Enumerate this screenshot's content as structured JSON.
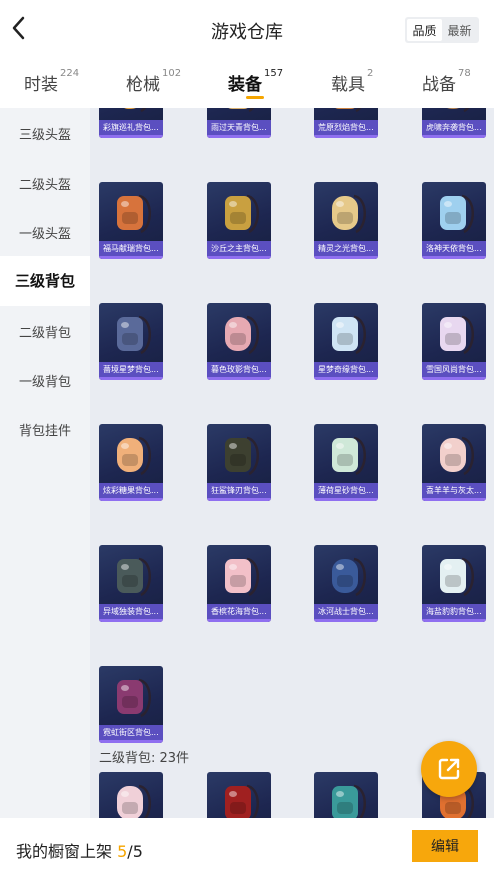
{
  "header": {
    "title": "游戏仓库",
    "sort_options": [
      "品质",
      "最新"
    ],
    "sort_active": 0
  },
  "tabs": [
    {
      "label": "时装",
      "count": "224"
    },
    {
      "label": "枪械",
      "count": "102"
    },
    {
      "label": "装备",
      "count": "157"
    },
    {
      "label": "载具",
      "count": "2"
    },
    {
      "label": "战备",
      "count": "78"
    }
  ],
  "active_tab": 2,
  "sidebar": {
    "items": [
      "三级头盔",
      "二级头盔",
      "一级头盔",
      "三级背包",
      "二级背包",
      "一级背包",
      "背包挂件"
    ],
    "active": 3
  },
  "items": [
    {
      "name": "彩旗巡礼背包...",
      "color": "#e0a040"
    },
    {
      "name": "雨过天青背包...",
      "color": "#d8b070"
    },
    {
      "name": "荒原烈焰背包...",
      "color": "#c98040"
    },
    {
      "name": "虎啸奔袭背包...",
      "color": "#b08050"
    },
    {
      "name": "福马献瑞背包...",
      "color": "#d7733c"
    },
    {
      "name": "沙丘之主背包...",
      "color": "#c9a040"
    },
    {
      "name": "精灵之光背包...",
      "color": "#e6c98a"
    },
    {
      "name": "洛神天依背包...",
      "color": "#9fd0ef"
    },
    {
      "name": "薔境星梦背包...",
      "color": "#5a6a9a"
    },
    {
      "name": "暮色玫影背包...",
      "color": "#e6a9b2"
    },
    {
      "name": "星梦奇缘背包...",
      "color": "#cfe4f4"
    },
    {
      "name": "雪国风尚背包...",
      "color": "#e8d8f0"
    },
    {
      "name": "炫彩糖果背包...",
      "color": "#f0b07a"
    },
    {
      "name": "狂鲨锋刃背包...",
      "color": "#3d4030"
    },
    {
      "name": "薄荷星砂背包...",
      "color": "#cfe8d8"
    },
    {
      "name": "喜羊羊与灰太...",
      "color": "#f2d0cc"
    },
    {
      "name": "异域独装背包...",
      "color": "#4a5a5a"
    },
    {
      "name": "香槟花海背包...",
      "color": "#f2c0c8"
    },
    {
      "name": "冰河战士背包...",
      "color": "#3a5a9a"
    },
    {
      "name": "海盐豹豹背包...",
      "color": "#e4f0f2"
    },
    {
      "name": "霓虹街区背包...",
      "color": "#8a3a70"
    }
  ],
  "second_section": {
    "label": "二级背包: 23件",
    "item_colors": [
      "#f0d0d8",
      "#a02020",
      "#3a9a9a",
      "#e07030"
    ]
  },
  "footer": {
    "label": "我的橱窗上架",
    "current": "5",
    "total": "/5",
    "edit_label": "编辑"
  },
  "colors": {
    "accent": "#f7a70c",
    "card_label_bg": "#5b4fc0"
  },
  "icons": {
    "back": "chevron-left-icon",
    "fab": "share-external-icon"
  }
}
